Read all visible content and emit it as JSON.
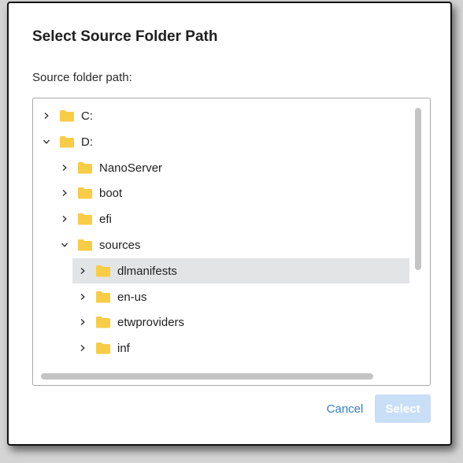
{
  "dialog": {
    "title": "Select Source Folder Path",
    "field_label": "Source folder path:",
    "cancel_label": "Cancel",
    "select_label": "Select",
    "select_enabled": false
  },
  "tree": {
    "nodes": [
      {
        "label": "C:",
        "depth": 0,
        "expanded": false,
        "selected": false
      },
      {
        "label": "D:",
        "depth": 0,
        "expanded": true,
        "selected": false
      },
      {
        "label": "NanoServer",
        "depth": 1,
        "expanded": false,
        "selected": false
      },
      {
        "label": "boot",
        "depth": 1,
        "expanded": false,
        "selected": false
      },
      {
        "label": "efi",
        "depth": 1,
        "expanded": false,
        "selected": false
      },
      {
        "label": "sources",
        "depth": 1,
        "expanded": true,
        "selected": false
      },
      {
        "label": "dlmanifests",
        "depth": 2,
        "expanded": false,
        "selected": true
      },
      {
        "label": "en-us",
        "depth": 2,
        "expanded": false,
        "selected": false
      },
      {
        "label": "etwproviders",
        "depth": 2,
        "expanded": false,
        "selected": false
      },
      {
        "label": "inf",
        "depth": 2,
        "expanded": false,
        "selected": false
      }
    ]
  },
  "icons": {
    "folder": "folder-icon",
    "collapsed": "chevron-right-icon",
    "expanded": "chevron-down-icon"
  },
  "colors": {
    "folder": "#f8cc45",
    "accent": "#2f7fd1",
    "selected_row": "#e3e4e6",
    "disabled_button": "#c9def7"
  }
}
